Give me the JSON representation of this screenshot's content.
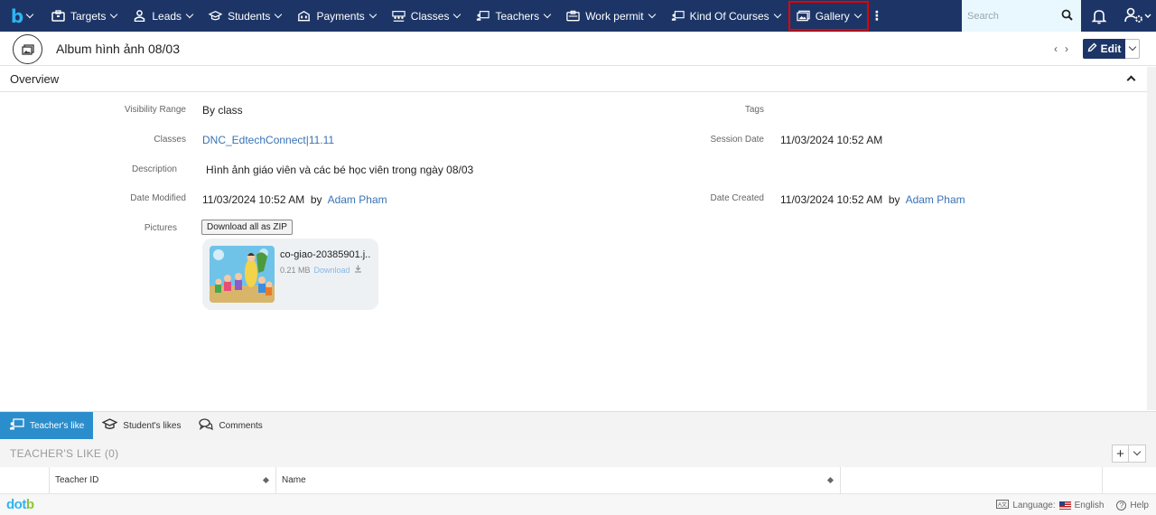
{
  "nav": {
    "items": [
      {
        "label": "Targets",
        "icon": "briefcase-icon"
      },
      {
        "label": "Leads",
        "icon": "person-icon"
      },
      {
        "label": "Students",
        "icon": "graduation-cap-icon"
      },
      {
        "label": "Payments",
        "icon": "building-icon"
      },
      {
        "label": "Classes",
        "icon": "classroom-icon"
      },
      {
        "label": "Teachers",
        "icon": "teacher-board-icon"
      },
      {
        "label": "Work permit",
        "icon": "id-card-icon"
      },
      {
        "label": "Kind Of Courses",
        "icon": "teacher-board-icon"
      },
      {
        "label": "Gallery",
        "icon": "gallery-icon"
      }
    ],
    "highlighted_item": "Gallery",
    "search_placeholder": "Search",
    "accent": "#1d3566",
    "highlight_color": "#e60000"
  },
  "record": {
    "title": "Album hình ảnh 08/03",
    "edit_label": "Edit"
  },
  "overview": {
    "title": "Overview",
    "fields": {
      "visibility_range": {
        "label": "Visibility Range",
        "value": "By class"
      },
      "tags": {
        "label": "Tags",
        "value": ""
      },
      "classes": {
        "label": "Classes",
        "value": "DNC_EdtechConnect|11.11"
      },
      "session_date": {
        "label": "Session Date",
        "value": "11/03/2024 10:52 AM"
      },
      "description": {
        "label": "Description",
        "value": "Hình ảnh giáo viên và các bé học viên trong ngày 08/03"
      },
      "date_modified": {
        "label": "Date Modified",
        "value": "11/03/2024 10:52 AM",
        "by_label": "by",
        "by_user": "Adam Pham"
      },
      "date_created": {
        "label": "Date Created",
        "value": "11/03/2024 10:52 AM",
        "by_label": "by",
        "by_user": "Adam Pham"
      },
      "pictures": {
        "label": "Pictures",
        "zip_label": "Download all as ZIP"
      }
    },
    "picture": {
      "file_name": "co-giao-20385901.j...",
      "size": "0.21 MB",
      "download_label": "Download"
    }
  },
  "tabs": [
    {
      "label": "Teacher's like",
      "icon": "teacher-board-icon",
      "active": true
    },
    {
      "label": "Student's likes",
      "icon": "graduation-cap-icon",
      "active": false
    },
    {
      "label": "Comments",
      "icon": "comments-icon",
      "active": false
    }
  ],
  "subpanel": {
    "title": "TEACHER'S LIKE (0)",
    "columns": [
      "Teacher ID",
      "Name"
    ]
  },
  "footer": {
    "logo_part1": "dot",
    "logo_part2": "b",
    "language_label": "Language:",
    "language_value": "English",
    "help_label": "Help"
  }
}
